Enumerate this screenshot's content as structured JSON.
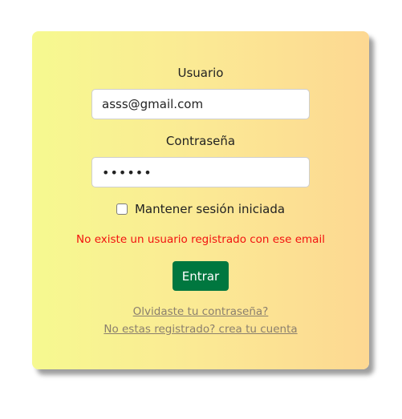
{
  "form": {
    "username_label": "Usuario",
    "username_value": "asss@gmail.com",
    "password_label": "Contraseña",
    "password_value": "••••••",
    "remember_label": "Mantener sesión iniciada",
    "remember_checked": false,
    "error_message": "No existe un usuario registrado con ese email",
    "submit_label": "Entrar",
    "forgot_link": "Olvidaste tu contraseña?",
    "register_link": "No estas registrado? crea tu cuenta"
  },
  "colors": {
    "gradient_start": "#f6f990",
    "gradient_end": "#fdd892",
    "submit_button": "#00773f",
    "error_text": "#f2120f",
    "link_text": "#8a7f6e"
  }
}
